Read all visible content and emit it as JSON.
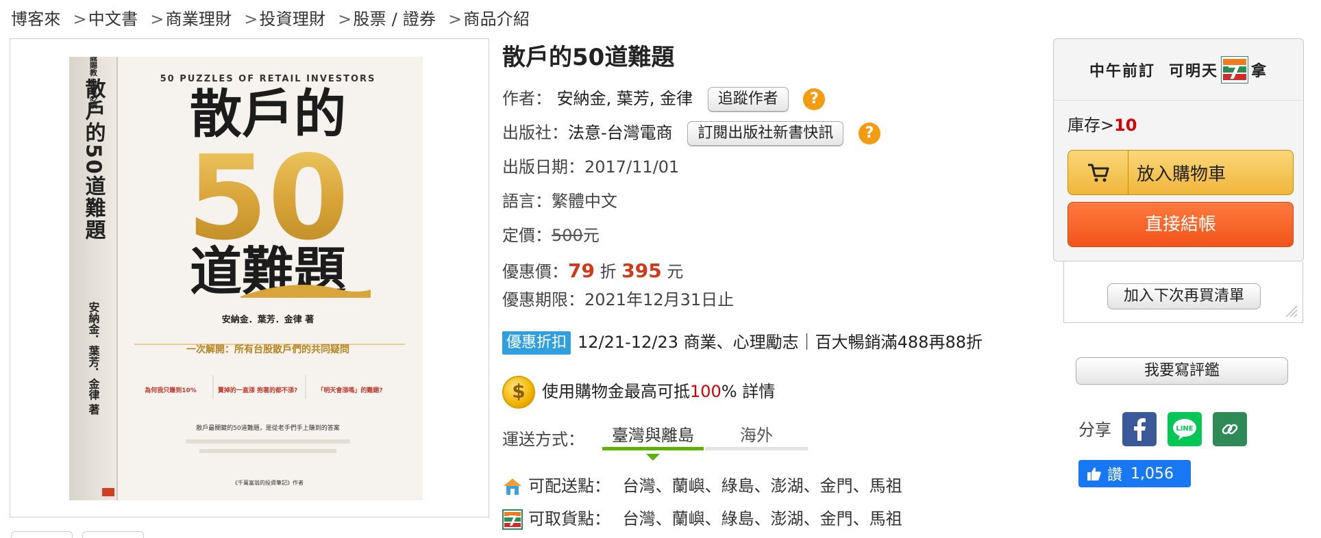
{
  "breadcrumb": [
    "博客來",
    "中文書",
    "商業理財",
    "投資理財",
    "股票 / 證券",
    "商品介紹"
  ],
  "breadcrumb_sep": ">",
  "cover": {
    "en_title": "50 PUZZLES OF RETAIL INVESTORS",
    "title_a": "散戶的",
    "title_num": "50",
    "title_b": "道難題",
    "spine_top": "開誠賜教 投資必讀",
    "spine_title": "散戶的50道難題",
    "spine_authors": "安納金．葉芳．金律 著",
    "authors": "安納金．葉芳．金律 著",
    "tagline": "一次解開：所有台股散戶們的共同疑問",
    "q1": "為何我只賺到10%",
    "q2": "賣掉的一直漲 抱著的都不漲?",
    "q3": "「明天會漲嗎」的難題?",
    "blurb": "散戶最關鍵的50道難題，是從老手們手上賺到的答案",
    "footer": "《千萬富翁的投資筆記》作者"
  },
  "product": {
    "title": "散戶的50道難題",
    "author_label": "作者：",
    "authors": "安納金, 葉芳, 金律",
    "follow_author": "追蹤作者",
    "publisher_label": "出版社：",
    "publisher": "法意-台灣電商",
    "subscribe_publisher": "訂閱出版社新書快訊",
    "help_glyph": "?",
    "pubdate": "出版日期：2017/11/01",
    "language": "語言：繁體中文",
    "list_price_label": "定價：",
    "list_price": "500",
    "currency": "元",
    "sale_label": "優惠價：",
    "discount": "79",
    "discount_unit": "折",
    "sale_price": "395",
    "sale_until": "優惠期限：2021年12月31日止",
    "promo_badge": "優惠折扣",
    "promo_text": "12/21-12/23 商業、心理勵志｜百大暢銷滿488再88折",
    "coin_glyph": "$",
    "coin_text_a": "使用購物金最高可抵",
    "coin_pct": "100",
    "coin_text_b": "% 詳情",
    "shipping_label": "運送方式：",
    "tab_domestic": "臺灣與離島",
    "tab_overseas": "海外",
    "delivery_label": "可配送點：",
    "delivery_places": "台灣、蘭嶼、綠島、澎湖、金門、馬祖",
    "pickup_label": "可取貨點：",
    "pickup_places": "台灣、蘭嶼、綠島、澎湖、金門、馬祖"
  },
  "buy": {
    "head_a": "中午前訂",
    "head_b": "可明天",
    "head_c": "拿",
    "stock_label": "庫存>",
    "stock": "10",
    "add_to_cart": "放入購物車",
    "checkout": "直接結帳",
    "wishlist": "加入下次再買清單",
    "review": "我要寫評鑑",
    "share": "分享",
    "like_label": "讚",
    "like_count": "1,056"
  },
  "colors": {
    "accent_red": "#d60000",
    "price_red": "#d03a1b",
    "cart_yellow": "#f0b63a",
    "checkout_orange": "#f2541b",
    "tab_green": "#5bb300",
    "facebook_blue": "#3b5998",
    "line_green": "#06c755",
    "link_green": "#2e8b57"
  }
}
